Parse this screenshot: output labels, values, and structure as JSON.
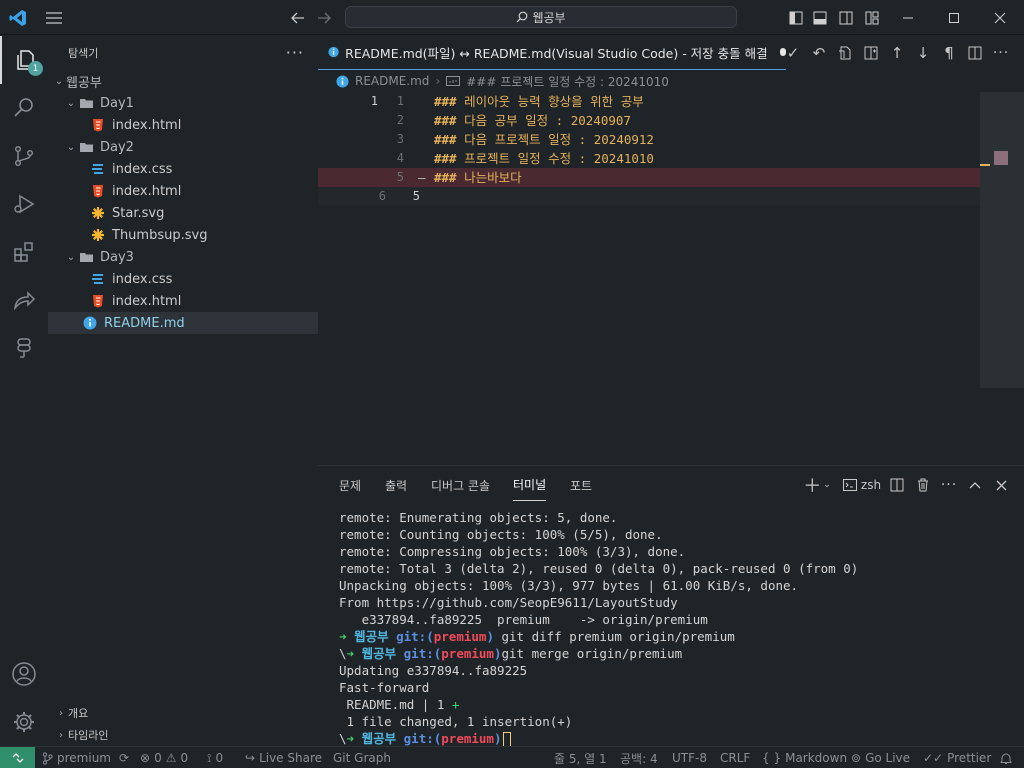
{
  "titlebar": {
    "command_center": "웹공부"
  },
  "activitybar": {
    "explorer_badge": "1"
  },
  "sidebar": {
    "title": "탐색기",
    "more": "···",
    "root": "웹공부",
    "items": [
      {
        "label": "Day1",
        "kind": "folder"
      },
      {
        "label": "index.html",
        "kind": "html"
      },
      {
        "label": "Day2",
        "kind": "folder"
      },
      {
        "label": "index.css",
        "kind": "css"
      },
      {
        "label": "index.html",
        "kind": "html"
      },
      {
        "label": "Star.svg",
        "kind": "svg"
      },
      {
        "label": "Thumbsup.svg",
        "kind": "svg"
      },
      {
        "label": "Day3",
        "kind": "folder"
      },
      {
        "label": "index.css",
        "kind": "css"
      },
      {
        "label": "index.html",
        "kind": "html"
      },
      {
        "label": "README.md",
        "kind": "info"
      }
    ],
    "outline": "개요",
    "timeline": "타임라인"
  },
  "editor": {
    "tab_label": "README.md(파일) ↔ README.md(Visual Studio Code) - 저장 충돌 해결",
    "breadcrumb_file": "README.md",
    "breadcrumb_symbol": "### 프로젝트 일정 수정 : 20241010",
    "lines": [
      {
        "left": "1",
        "right": "1",
        "text": "레이아웃 능력 향상을 위한 공부"
      },
      {
        "left": "",
        "right": "2",
        "text": "다음 공부 일정 : 20240907"
      },
      {
        "left": "",
        "right": "3",
        "text": "다음 프로젝트 일정 : 20240912"
      },
      {
        "left": "",
        "right": "4",
        "text": "프로젝트 일정 수정 : 20241010"
      },
      {
        "left": "",
        "right": "5",
        "text": "나는바보다"
      },
      {
        "left": "",
        "right": "6",
        "text": ""
      }
    ],
    "hash": "###",
    "line5_right": "5",
    "deleted_marker": "—"
  },
  "panel": {
    "tabs": [
      "문제",
      "출력",
      "디버그 콘솔",
      "터미널",
      "포트"
    ],
    "active_tab": "터미널",
    "shell": "zsh",
    "terminal": [
      "remote: Enumerating objects: 5, done.",
      "remote: Counting objects: 100% (5/5), done.",
      "remote: Compressing objects: 100% (3/3), done.",
      "remote: Total 3 (delta 2), reused 0 (delta 0), pack-reused 0 (from 0)",
      "Unpacking objects: 100% (3/3), 977 bytes | 61.00 KiB/s, done.",
      "From https://github.com/SeopE9611/LayoutStudy",
      "   e337894..fa89225  premium    -> origin/premium"
    ],
    "prompt_dir": "웹공부",
    "git_label": "git:(",
    "branch": "premium",
    "git_close": ")",
    "cmd1": " git diff premium origin/premium",
    "cmd2": "git merge origin/premium",
    "backslash": "\\",
    "arrow": "➜",
    "after": [
      "Updating e337894..fa89225",
      "Fast-forward",
      " README.md | 1 "
    ],
    "plus": "+",
    "summary": " 1 file changed, 1 insertion(+)"
  },
  "statusbar": {
    "branch": "premium",
    "errors": "0",
    "warnings": "0",
    "ports": "0",
    "live_share": "Live Share",
    "git_graph": "Git Graph",
    "position": "줄 5, 열 1",
    "spaces": "공백: 4",
    "encoding": "UTF-8",
    "eol": "CRLF",
    "language": "Markdown",
    "go_live": "Go Live",
    "prettier": "Prettier"
  }
}
